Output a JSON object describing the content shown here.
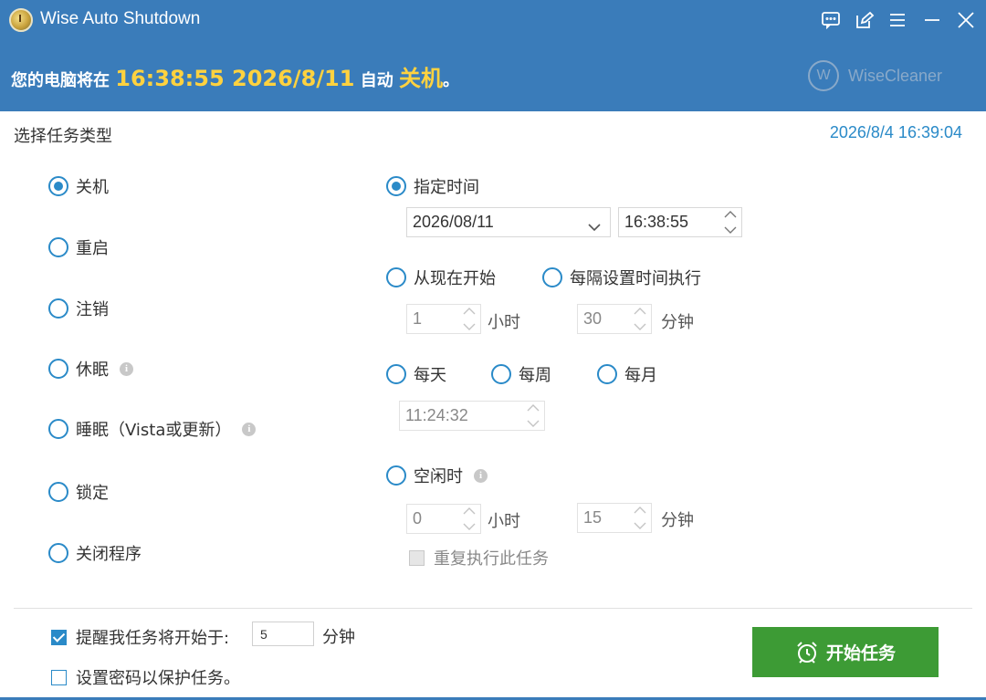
{
  "window": {
    "title": "Wise Auto Shutdown"
  },
  "banner": {
    "prefix": "您的电脑将在 ",
    "time": "16:38:55 2026/8/11",
    "middle": " 自动 ",
    "action": "关机",
    "suffix": "。",
    "brand": "WiseCleaner"
  },
  "section_title": "选择任务类型",
  "current_time": "2026/8/4 16:39:04",
  "task_types": [
    {
      "label": "关机",
      "checked": true
    },
    {
      "label": "重启",
      "checked": false
    },
    {
      "label": "注销",
      "checked": false
    },
    {
      "label": "休眠",
      "checked": false
    },
    {
      "label": "睡眠（Vista或更新）",
      "checked": false
    },
    {
      "label": "锁定",
      "checked": false
    },
    {
      "label": "关闭程序",
      "checked": false
    }
  ],
  "schedule": {
    "specified_time": {
      "label": "指定时间",
      "checked": true,
      "date": "2026/08/11",
      "time": "16:38:55"
    },
    "from_now": {
      "label": "从现在开始",
      "checked": false
    },
    "interval": {
      "label": "每隔设置时间执行",
      "checked": false
    },
    "hours_value": "1",
    "hours_unit": "小时",
    "minutes_value": "30",
    "minutes_unit": "分钟",
    "daily": {
      "label": "每天",
      "checked": false
    },
    "weekly": {
      "label": "每周",
      "checked": false
    },
    "monthly": {
      "label": "每月",
      "checked": false
    },
    "periodic_time": "11:24:32",
    "idle": {
      "label": "空闲时",
      "checked": false
    },
    "idle_hours_value": "0",
    "idle_hours_unit": "小时",
    "idle_minutes_value": "15",
    "idle_minutes_unit": "分钟",
    "repeat_label": "重复执行此任务"
  },
  "footer": {
    "remind_label": "提醒我任务将开始于:",
    "remind_value": "5",
    "remind_unit": "分钟",
    "password_label": "设置密码以保护任务。",
    "start_button": "开始任务"
  },
  "colors": {
    "titlebar": "#3a7cba",
    "highlight": "#ffd23f",
    "accent": "#2a8ac8",
    "start_button": "#3d9b35"
  }
}
